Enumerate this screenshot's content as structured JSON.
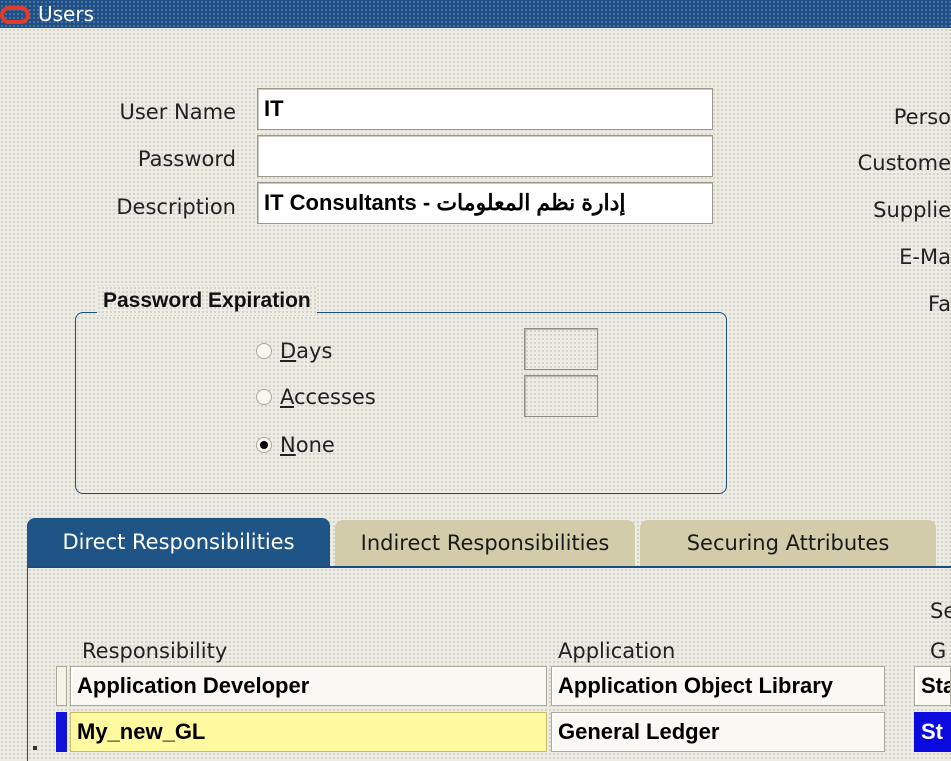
{
  "window": {
    "title": "Users"
  },
  "form": {
    "user_name_label": "User Name",
    "user_name_value": "IT",
    "password_label": "Password",
    "password_value": "",
    "description_label": "Description",
    "description_value": "IT Consultants - إدارة نظم المعلومات"
  },
  "right_labels": {
    "person": "Perso",
    "customer": "Custome",
    "supplier": "Supplie",
    "email": "E-Ma",
    "fax": "Fa"
  },
  "password_expiration": {
    "title": "Password Expiration",
    "options": [
      {
        "label": "Days",
        "mnemonic": "D",
        "rest": "ays",
        "checked": false,
        "value": ""
      },
      {
        "label": "Accesses",
        "mnemonic": "A",
        "rest": "ccesses",
        "checked": false,
        "value": ""
      },
      {
        "label": "None",
        "mnemonic": "N",
        "rest": "one",
        "checked": true
      }
    ]
  },
  "tabs": [
    {
      "label": "Direct Responsibilities",
      "active": true
    },
    {
      "label": "Indirect Responsibilities",
      "active": false
    },
    {
      "label": "Securing Attributes",
      "active": false
    }
  ],
  "table": {
    "header_group_top": "Se",
    "columns": [
      "Responsibility",
      "Application",
      "G"
    ],
    "rows": [
      {
        "responsibility": "Application Developer",
        "application": "Application Object Library",
        "security_group": "Sta"
      },
      {
        "responsibility": "My_new_GL",
        "application": "General Ledger",
        "security_group": "St"
      }
    ]
  },
  "colors": {
    "titlebar": "#1f4f84",
    "active_tab": "#1f5487",
    "selected_row": "#fffaa0",
    "highlight": "#0a0adf"
  }
}
